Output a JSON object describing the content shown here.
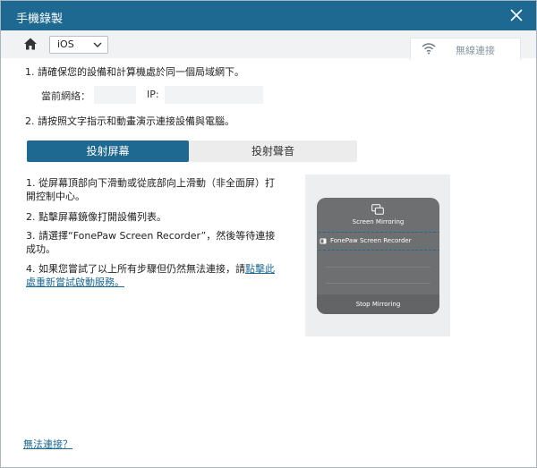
{
  "window": {
    "title": "手機錄製"
  },
  "toolbar": {
    "os_value": "iOS",
    "wifi_tab_label": "無線連接"
  },
  "network": {
    "step1": "1. 請確保您的設備和計算機處於同一個局域網下。",
    "network_label": "當前網絡：",
    "ip_label": "IP:",
    "network_value": "",
    "ip_value": ""
  },
  "step2": "2. 請按照文字指示和動畫演示連接設備與電腦。",
  "tabs": [
    {
      "label": "投射屏幕",
      "active": true
    },
    {
      "label": "投射聲音",
      "active": false
    }
  ],
  "instructions": [
    "1. 從屏幕頂部向下滑動或從底部向上滑動（非全面屏）打開控制中心。",
    "2. 點擊屏幕鏡像打開設備列表。",
    "3. 請選擇“FonePaw Screen Recorder”，然後等待連接成功。"
  ],
  "instruction4": {
    "text": "4. 如果您嘗試了以上所有步驟但仍然無法連接，請",
    "link": "點擊此處重新嘗試啟動服務。"
  },
  "phone": {
    "title": "Screen Mirroring",
    "device": "FonePaw Screen Recorder",
    "stop": "Stop Mirroring"
  },
  "footer": {
    "help_link": "無法連接？"
  },
  "colors": {
    "accent": "#1e6991",
    "title_bar": "#1e6991"
  }
}
